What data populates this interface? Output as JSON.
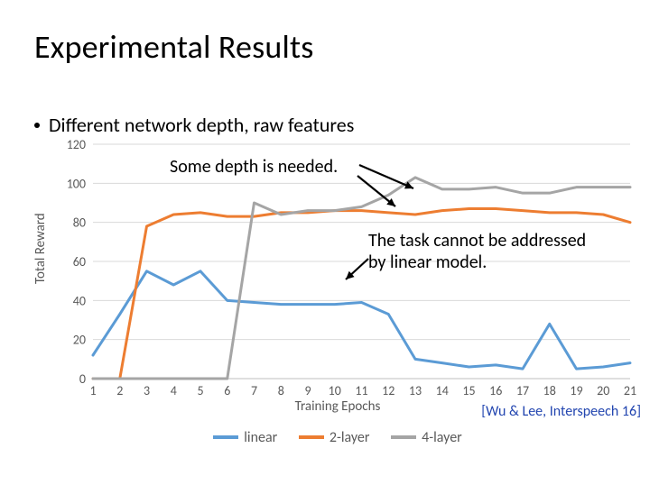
{
  "title": "Experimental Results",
  "bullet": "Different network depth, raw features",
  "annotations": {
    "depth_note": "Some depth is needed.",
    "linear_note_line1": "The task cannot be addressed",
    "linear_note_line2": "by linear model."
  },
  "citation": "[Wu & Lee, Interspeech 16]",
  "chart_data": {
    "type": "line",
    "title": "",
    "xlabel": "Training Epochs",
    "ylabel": "Total Reward",
    "ylim": [
      0,
      120
    ],
    "categories": [
      1,
      2,
      3,
      4,
      5,
      6,
      7,
      8,
      9,
      10,
      11,
      12,
      13,
      14,
      15,
      16,
      17,
      18,
      19,
      20,
      21
    ],
    "series": [
      {
        "name": "linear",
        "color": "#5B9BD5",
        "values": [
          12,
          33,
          55,
          48,
          55,
          40,
          39,
          38,
          38,
          38,
          39,
          33,
          10,
          8,
          6,
          7,
          5,
          28,
          5,
          6,
          8
        ]
      },
      {
        "name": "2-layer",
        "color": "#ED7D31",
        "values": [
          0,
          0,
          78,
          84,
          85,
          83,
          83,
          85,
          85,
          86,
          86,
          85,
          84,
          86,
          87,
          87,
          86,
          85,
          85,
          84,
          80
        ]
      },
      {
        "name": "4-layer",
        "color": "#A5A5A5",
        "values": [
          0,
          0,
          0,
          0,
          0,
          0,
          90,
          84,
          86,
          86,
          88,
          94,
          103,
          97,
          97,
          98,
          95,
          95,
          98,
          98,
          98
        ]
      }
    ],
    "legend_position": "bottom"
  }
}
